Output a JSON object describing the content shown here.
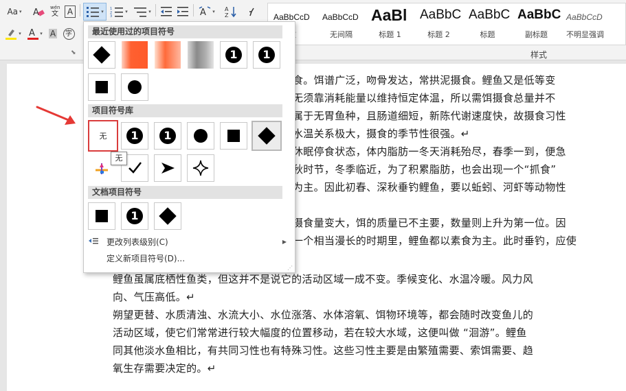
{
  "ribbon": {
    "font_size_label": "Aa",
    "clear_format_label": "A",
    "pinyin_label": "wén",
    "border_char_label": "A",
    "char_shade_label": "A",
    "enclose_label": "字",
    "styles_group_label": "样式",
    "styles": [
      {
        "sample": "AaBbCcD",
        "name": "文"
      },
      {
        "sample": "AaBbCcD",
        "name": "无间隔"
      },
      {
        "sample": "AaBl",
        "name": "标题 1"
      },
      {
        "sample": "AaBbC",
        "name": "标题 2"
      },
      {
        "sample": "AaBbC",
        "name": "标题"
      },
      {
        "sample": "AaBbC",
        "name": "副标题"
      },
      {
        "sample": "AaBbCcD",
        "name": "不明显强调"
      }
    ],
    "colors": {
      "highlight": "#ffe600",
      "font_color": "#e02020"
    }
  },
  "dropdown": {
    "recent_header": "最近使用过的项目符号",
    "library_header": "项目符号库",
    "document_header": "文档项目符号",
    "none_label": "无",
    "tooltip": "无",
    "recent_row1": [
      "diamond",
      "blurred",
      "blurred",
      "blurred",
      "one-circle",
      "one-circle"
    ],
    "recent_row2": [
      "square",
      "circle"
    ],
    "library_row1": [
      "none",
      "one-circle",
      "one-circle",
      "circle",
      "square",
      "diamond"
    ],
    "library_row2": [
      "colorful-arrow",
      "checkmark",
      "arrowhead",
      "four-point-star"
    ],
    "document_row": [
      "square",
      "one-circle",
      "diamond"
    ],
    "one_glyph": "1",
    "menu": {
      "change_level": "更改列表级别(C)",
      "define_new": "定义新项目符号(D)..."
    }
  },
  "document": {
    "lines": [
      "食。饵谱广泛，吻骨发达，常拱泥摄食。鲤鱼又是低等变",
      "无须靠消耗能量以维持恒定体温，所以需饵摄食总量并不",
      "属于无胃鱼种，且肠道细短，新陈代谢速度快，故摄食习性",
      "水温关系极大，摄食的季节性很强。↵",
      "休眠停食状态，体内脂肪一冬天消耗殆尽，春季一到，便急",
      "秋时节，冬季临近，为了积累脂肪，也会出现一个“抓食”",
      "为主。因此初春、深秋垂钓鲤鱼，要以蚯蚓、河虾等动物性",
      "",
      "摄食量变大，饵的质量已不主要，数量则上升为第一位。因",
      "一个相当漫长的时期里，鲤鱼都以素食为主。此时垂钓，应使",
      "鲤鱼虽属底栖性鱼类，但这并不是说它的活动区域一成不变。季候变化、水温冷暖。风力风",
      "向、气压高低。↵",
      "朔望更替、水质清浊、水流大小、水位涨落、水体溶氧、饵物环境等，都会随时改变鱼儿的",
      "活动区域，使它们常常进行较大幅度的位置移动，若在较大水域，这便叫做 “洄游”。鲤鱼",
      "同其他淡水鱼相比，有共同习性也有特殊习性。这些习性主要是由繁殖需要、索饵需要、趋",
      "氧生存需要决定的。↵"
    ]
  }
}
